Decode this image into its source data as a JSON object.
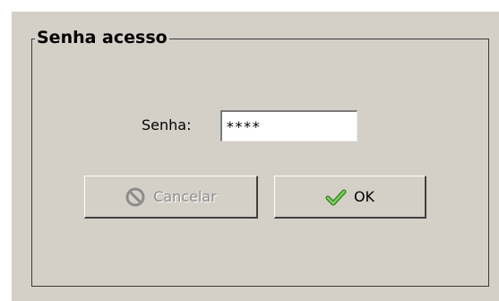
{
  "dialog": {
    "group_title": "Senha acesso",
    "password_label": "Senha:",
    "password_value": "****",
    "cancel_label": "Cancelar",
    "ok_label": "OK",
    "cancel_enabled": false
  },
  "icons": {
    "cancel": "no-entry-icon",
    "ok": "checkmark-icon"
  },
  "colors": {
    "panel_bg": "#d4d0c8",
    "disabled_text": "#8c8c8c",
    "check_green": "#3aa82b"
  }
}
